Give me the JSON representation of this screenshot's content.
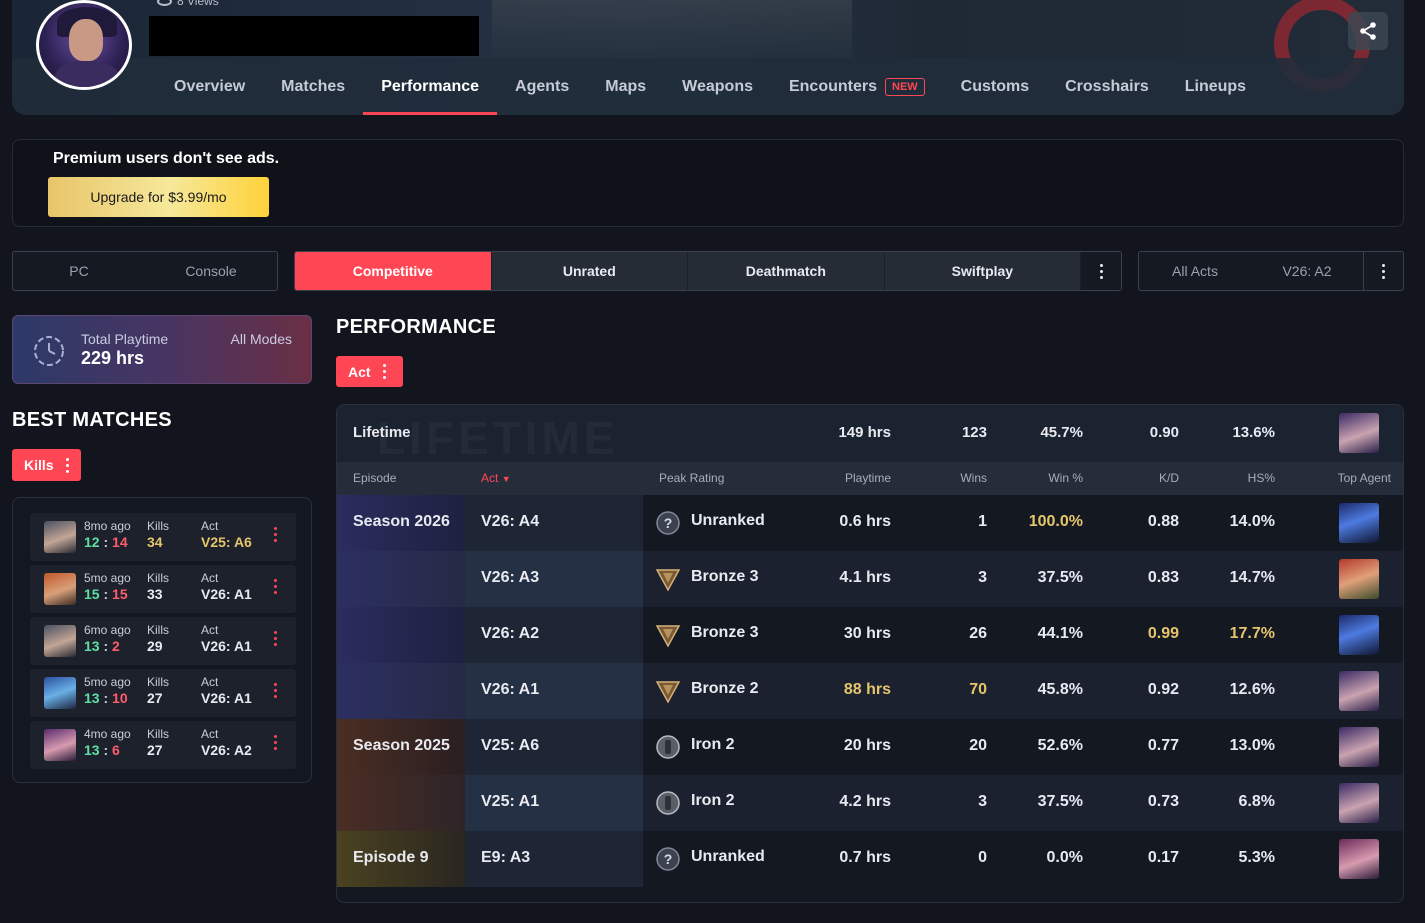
{
  "header": {
    "views": "8 Views",
    "nav": [
      {
        "label": "Overview"
      },
      {
        "label": "Matches"
      },
      {
        "label": "Performance"
      },
      {
        "label": "Agents"
      },
      {
        "label": "Maps"
      },
      {
        "label": "Weapons"
      },
      {
        "label": "Encounters",
        "badge": "NEW"
      },
      {
        "label": "Customs"
      },
      {
        "label": "Crosshairs"
      },
      {
        "label": "Lineups"
      }
    ],
    "active_tab": "Performance"
  },
  "premium": {
    "message": "Premium users don't see ads.",
    "button": "Upgrade for $3.99/mo"
  },
  "platform": {
    "options": [
      "PC",
      "Console"
    ]
  },
  "modes": {
    "options": [
      "Competitive",
      "Unrated",
      "Deathmatch",
      "Swiftplay"
    ],
    "active": "Competitive"
  },
  "acts": {
    "options": [
      "All Acts",
      "V26: A2"
    ]
  },
  "playtime": {
    "label": "Total Playtime",
    "value": "229 hrs",
    "scope": "All Modes"
  },
  "best_matches": {
    "title": "BEST MATCHES",
    "filter": "Kills",
    "items": [
      {
        "ago": "8mo ago",
        "won": "12",
        "lost": "14",
        "kills_label": "Kills",
        "kills": "34",
        "act_label": "Act",
        "act": "V25: A6"
      },
      {
        "ago": "5mo ago",
        "won": "15",
        "lost": "15",
        "kills_label": "Kills",
        "kills": "33",
        "act_label": "Act",
        "act": "V26: A1"
      },
      {
        "ago": "6mo ago",
        "won": "13",
        "lost": "2",
        "kills_label": "Kills",
        "kills": "29",
        "act_label": "Act",
        "act": "V26: A1"
      },
      {
        "ago": "5mo ago",
        "won": "13",
        "lost": "10",
        "kills_label": "Kills",
        "kills": "27",
        "act_label": "Act",
        "act": "V26: A1"
      },
      {
        "ago": "4mo ago",
        "won": "13",
        "lost": "6",
        "kills_label": "Kills",
        "kills": "27",
        "act_label": "Act",
        "act": "V26: A2"
      }
    ]
  },
  "performance": {
    "title": "PERFORMANCE",
    "filter": "Act",
    "lifetime": {
      "label": "Lifetime",
      "watermark": "LIFETIME",
      "playtime": "149 hrs",
      "wins": "123",
      "win_pct": "45.7%",
      "kd": "0.90",
      "hs": "13.6%"
    },
    "columns": [
      "Episode",
      "Act",
      "Peak Rating",
      "Playtime",
      "Wins",
      "Win %",
      "K/D",
      "HS%",
      "Top Agent"
    ],
    "rows": [
      {
        "episode": "Season 2026",
        "act": "V26: A4",
        "rating": "Unranked",
        "rating_tier": "unranked",
        "playtime": "0.6 hrs",
        "wins": "1",
        "win_pct": "100.0%",
        "kd": "0.88",
        "hs": "14.0%",
        "agent": "hooded"
      },
      {
        "episode": "",
        "act": "V26: A3",
        "rating": "Bronze 3",
        "rating_tier": "bronze",
        "playtime": "4.1 hrs",
        "wins": "3",
        "win_pct": "37.5%",
        "kd": "0.83",
        "hs": "14.7%",
        "agent": "redhair"
      },
      {
        "episode": "",
        "act": "V26: A2",
        "rating": "Bronze 3",
        "rating_tier": "bronze",
        "playtime": "30 hrs",
        "wins": "26",
        "win_pct": "44.1%",
        "kd": "0.99",
        "hs": "17.7%",
        "agent": "hooded"
      },
      {
        "episode": "",
        "act": "V26: A1",
        "rating": "Bronze 2",
        "rating_tier": "bronze",
        "playtime": "88 hrs",
        "wins": "70",
        "win_pct": "45.8%",
        "kd": "0.92",
        "hs": "12.6%",
        "agent": "purple"
      },
      {
        "episode": "Season 2025",
        "act": "V25: A6",
        "rating": "Iron 2",
        "rating_tier": "iron",
        "playtime": "20 hrs",
        "wins": "20",
        "win_pct": "52.6%",
        "kd": "0.77",
        "hs": "13.0%",
        "agent": "purple"
      },
      {
        "episode": "",
        "act": "V25: A1",
        "rating": "Iron 2",
        "rating_tier": "iron",
        "playtime": "4.2 hrs",
        "wins": "3",
        "win_pct": "37.5%",
        "kd": "0.73",
        "hs": "6.8%",
        "agent": "purple"
      },
      {
        "episode": "Episode 9",
        "act": "E9: A3",
        "rating": "Unranked",
        "rating_tier": "unranked",
        "playtime": "0.7 hrs",
        "wins": "0",
        "win_pct": "0.0%",
        "kd": "0.17",
        "hs": "5.3%",
        "agent": "pinkhair"
      }
    ]
  },
  "colors": {
    "accent": "#ff4655",
    "gold": "#e6c56b",
    "win": "#5fe0a3",
    "loss": "#ff5c6c"
  }
}
